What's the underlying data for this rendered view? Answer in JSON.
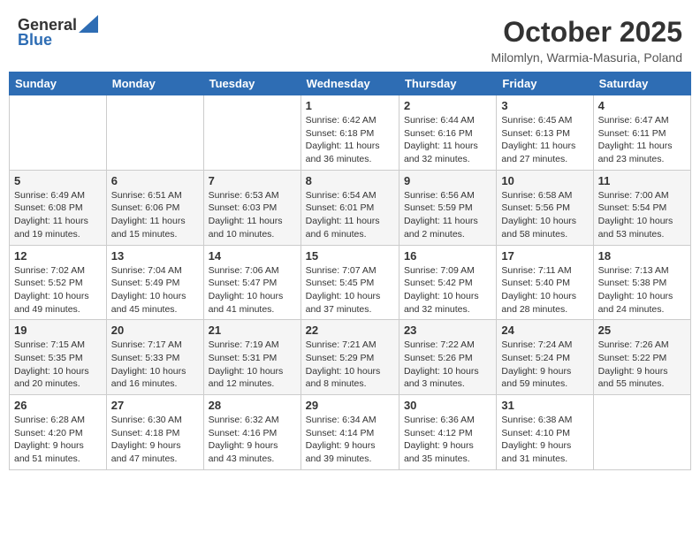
{
  "header": {
    "logo_general": "General",
    "logo_blue": "Blue",
    "month_title": "October 2025",
    "location": "Milomlyn, Warmia-Masuria, Poland"
  },
  "calendar": {
    "days_of_week": [
      "Sunday",
      "Monday",
      "Tuesday",
      "Wednesday",
      "Thursday",
      "Friday",
      "Saturday"
    ],
    "weeks": [
      [
        {
          "day": "",
          "info": ""
        },
        {
          "day": "",
          "info": ""
        },
        {
          "day": "",
          "info": ""
        },
        {
          "day": "1",
          "info": "Sunrise: 6:42 AM\nSunset: 6:18 PM\nDaylight: 11 hours\nand 36 minutes."
        },
        {
          "day": "2",
          "info": "Sunrise: 6:44 AM\nSunset: 6:16 PM\nDaylight: 11 hours\nand 32 minutes."
        },
        {
          "day": "3",
          "info": "Sunrise: 6:45 AM\nSunset: 6:13 PM\nDaylight: 11 hours\nand 27 minutes."
        },
        {
          "day": "4",
          "info": "Sunrise: 6:47 AM\nSunset: 6:11 PM\nDaylight: 11 hours\nand 23 minutes."
        }
      ],
      [
        {
          "day": "5",
          "info": "Sunrise: 6:49 AM\nSunset: 6:08 PM\nDaylight: 11 hours\nand 19 minutes."
        },
        {
          "day": "6",
          "info": "Sunrise: 6:51 AM\nSunset: 6:06 PM\nDaylight: 11 hours\nand 15 minutes."
        },
        {
          "day": "7",
          "info": "Sunrise: 6:53 AM\nSunset: 6:03 PM\nDaylight: 11 hours\nand 10 minutes."
        },
        {
          "day": "8",
          "info": "Sunrise: 6:54 AM\nSunset: 6:01 PM\nDaylight: 11 hours\nand 6 minutes."
        },
        {
          "day": "9",
          "info": "Sunrise: 6:56 AM\nSunset: 5:59 PM\nDaylight: 11 hours\nand 2 minutes."
        },
        {
          "day": "10",
          "info": "Sunrise: 6:58 AM\nSunset: 5:56 PM\nDaylight: 10 hours\nand 58 minutes."
        },
        {
          "day": "11",
          "info": "Sunrise: 7:00 AM\nSunset: 5:54 PM\nDaylight: 10 hours\nand 53 minutes."
        }
      ],
      [
        {
          "day": "12",
          "info": "Sunrise: 7:02 AM\nSunset: 5:52 PM\nDaylight: 10 hours\nand 49 minutes."
        },
        {
          "day": "13",
          "info": "Sunrise: 7:04 AM\nSunset: 5:49 PM\nDaylight: 10 hours\nand 45 minutes."
        },
        {
          "day": "14",
          "info": "Sunrise: 7:06 AM\nSunset: 5:47 PM\nDaylight: 10 hours\nand 41 minutes."
        },
        {
          "day": "15",
          "info": "Sunrise: 7:07 AM\nSunset: 5:45 PM\nDaylight: 10 hours\nand 37 minutes."
        },
        {
          "day": "16",
          "info": "Sunrise: 7:09 AM\nSunset: 5:42 PM\nDaylight: 10 hours\nand 32 minutes."
        },
        {
          "day": "17",
          "info": "Sunrise: 7:11 AM\nSunset: 5:40 PM\nDaylight: 10 hours\nand 28 minutes."
        },
        {
          "day": "18",
          "info": "Sunrise: 7:13 AM\nSunset: 5:38 PM\nDaylight: 10 hours\nand 24 minutes."
        }
      ],
      [
        {
          "day": "19",
          "info": "Sunrise: 7:15 AM\nSunset: 5:35 PM\nDaylight: 10 hours\nand 20 minutes."
        },
        {
          "day": "20",
          "info": "Sunrise: 7:17 AM\nSunset: 5:33 PM\nDaylight: 10 hours\nand 16 minutes."
        },
        {
          "day": "21",
          "info": "Sunrise: 7:19 AM\nSunset: 5:31 PM\nDaylight: 10 hours\nand 12 minutes."
        },
        {
          "day": "22",
          "info": "Sunrise: 7:21 AM\nSunset: 5:29 PM\nDaylight: 10 hours\nand 8 minutes."
        },
        {
          "day": "23",
          "info": "Sunrise: 7:22 AM\nSunset: 5:26 PM\nDaylight: 10 hours\nand 3 minutes."
        },
        {
          "day": "24",
          "info": "Sunrise: 7:24 AM\nSunset: 5:24 PM\nDaylight: 9 hours\nand 59 minutes."
        },
        {
          "day": "25",
          "info": "Sunrise: 7:26 AM\nSunset: 5:22 PM\nDaylight: 9 hours\nand 55 minutes."
        }
      ],
      [
        {
          "day": "26",
          "info": "Sunrise: 6:28 AM\nSunset: 4:20 PM\nDaylight: 9 hours\nand 51 minutes."
        },
        {
          "day": "27",
          "info": "Sunrise: 6:30 AM\nSunset: 4:18 PM\nDaylight: 9 hours\nand 47 minutes."
        },
        {
          "day": "28",
          "info": "Sunrise: 6:32 AM\nSunset: 4:16 PM\nDaylight: 9 hours\nand 43 minutes."
        },
        {
          "day": "29",
          "info": "Sunrise: 6:34 AM\nSunset: 4:14 PM\nDaylight: 9 hours\nand 39 minutes."
        },
        {
          "day": "30",
          "info": "Sunrise: 6:36 AM\nSunset: 4:12 PM\nDaylight: 9 hours\nand 35 minutes."
        },
        {
          "day": "31",
          "info": "Sunrise: 6:38 AM\nSunset: 4:10 PM\nDaylight: 9 hours\nand 31 minutes."
        },
        {
          "day": "",
          "info": ""
        }
      ]
    ]
  }
}
